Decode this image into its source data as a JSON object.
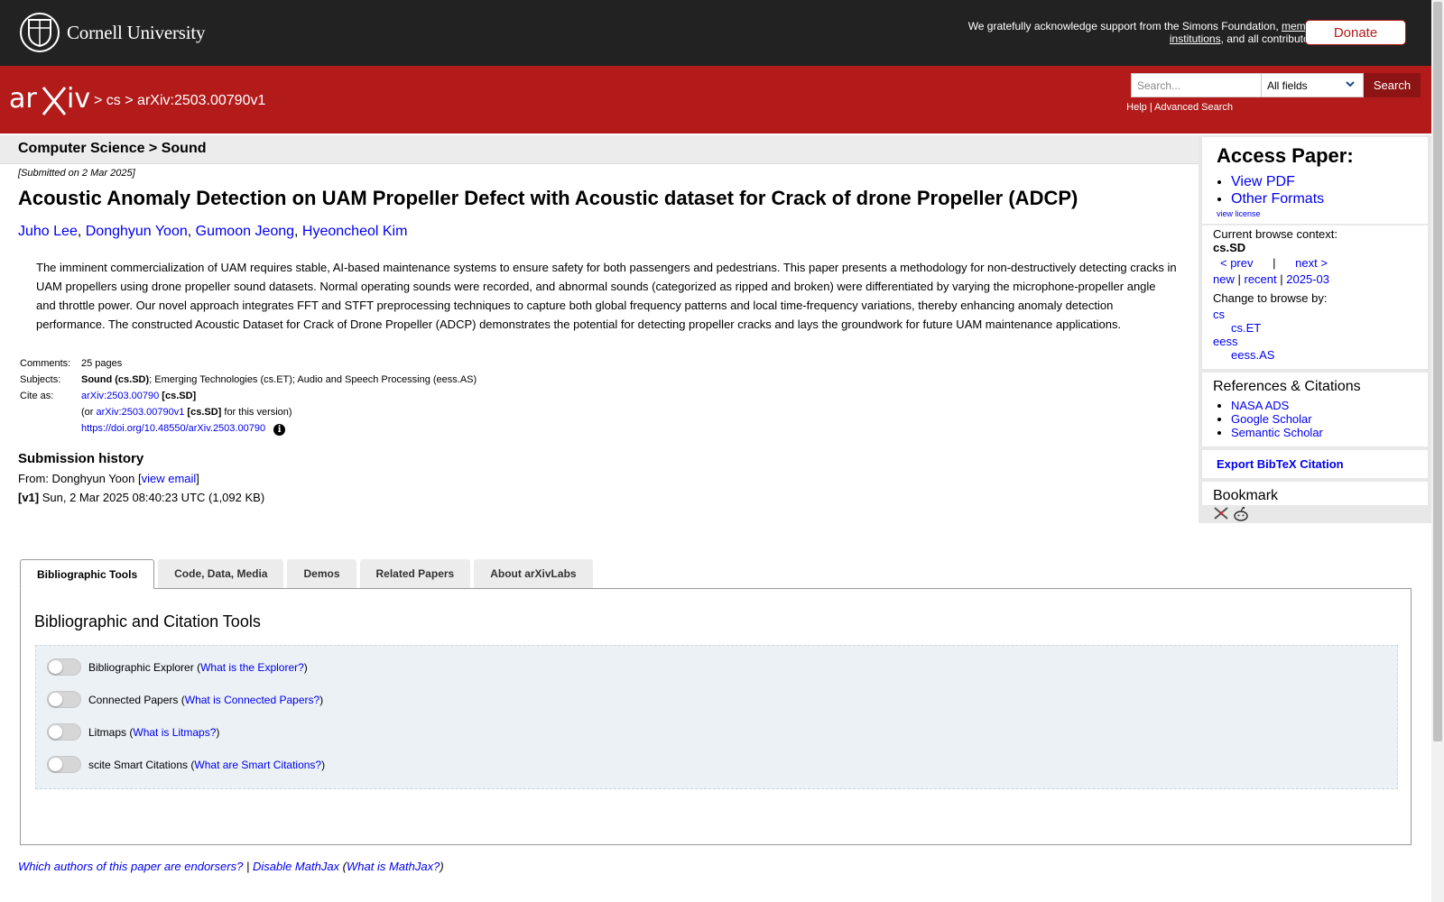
{
  "header": {
    "university": "Cornell University",
    "support_pre": "We gratefully acknowledge support from the Simons Foundation, ",
    "member_link": "member institutions",
    "support_post": ", and all contributors.",
    "donate": "Donate"
  },
  "nav": {
    "sep": ">",
    "crumb1": "cs",
    "crumb2": "arXiv:2503.00790v1",
    "search_placeholder": "Search...",
    "search_field": "All fields",
    "search_button": "Search",
    "help": "Help",
    "help_sep": "|",
    "advanced": "Advanced Search"
  },
  "subject_header": "Computer Science > Sound",
  "paper": {
    "submitted": "[Submitted on 2 Mar 2025]",
    "title": "Acoustic Anomaly Detection on UAM Propeller Defect with Acoustic dataset for Crack of drone Propeller (ADCP)",
    "authors": [
      "Juho Lee",
      "Donghyun Yoon",
      "Gumoon Jeong",
      "Hyeoncheol Kim"
    ],
    "abstract": "The imminent commercialization of UAM requires stable, AI-based maintenance systems to ensure safety for both passengers and pedestrians. This paper presents a methodology for non-destructively detecting cracks in UAM propellers using drone propeller sound datasets. Normal operating sounds were recorded, and abnormal sounds (categorized as ripped and broken) were differentiated by varying the microphone-propeller angle and throttle power. Our novel approach integrates FFT and STFT preprocessing techniques to capture both global frequency patterns and local time-frequency variations, thereby enhancing anomaly detection performance. The constructed Acoustic Dataset for Crack of Drone Propeller (ADCP) demonstrates the potential for detecting propeller cracks and lays the groundwork for future UAM maintenance applications.",
    "comments_label": "Comments:",
    "comments": "25 pages",
    "subjects_label": "Subjects:",
    "subjects_primary": "Sound (cs.SD)",
    "subjects_rest": "; Emerging Technologies (cs.ET); Audio and Speech Processing (eess.AS)",
    "cite_label": "Cite as:",
    "cite_id": "arXiv:2503.00790",
    "cite_cat": "[cs.SD]",
    "cite_or": "(or ",
    "cite_version": "arXiv:2503.00790v1",
    "cite_version_cat": "[cs.SD]",
    "cite_version_suffix": " for this version)",
    "doi": "https://doi.org/10.48550/arXiv.2503.00790"
  },
  "history": {
    "title": "Submission history",
    "from_label": "From: Donghyun Yoon [",
    "view_email": "view email",
    "from_close": "]",
    "v1_label": "[v1]",
    "v1_text": " Sun, 2 Mar 2025 08:40:23 UTC (1,092 KB)"
  },
  "sidebar": {
    "access_title": "Access Paper:",
    "view_pdf": "View PDF",
    "other_formats": "Other Formats",
    "view_license": "view license",
    "browse_context_label": "Current browse context:",
    "browse_context": "cs.SD",
    "prev": "< prev",
    "pipe": "|",
    "next": "next >",
    "new": "new",
    "recent": "recent",
    "month": "2025-03",
    "change_label": "Change to browse by:",
    "cats": [
      "cs",
      "cs.ET",
      "eess",
      "eess.AS"
    ],
    "refs_title": "References & Citations",
    "refs": [
      "NASA ADS",
      "Google Scholar",
      "Semantic Scholar"
    ],
    "export_bibtex": "Export BibTeX Citation",
    "bookmark_title": "Bookmark"
  },
  "tabs": [
    "Bibliographic Tools",
    "Code, Data, Media",
    "Demos",
    "Related Papers",
    "About arXivLabs"
  ],
  "panel": {
    "title": "Bibliographic and Citation Tools",
    "toggles": [
      {
        "label": "Bibliographic Explorer",
        "link": "What is the Explorer?"
      },
      {
        "label": "Connected Papers",
        "link": "What is Connected Papers?"
      },
      {
        "label": "Litmaps",
        "link": "What is Litmaps?"
      },
      {
        "label": "scite Smart Citations",
        "link": "What are Smart Citations?"
      }
    ]
  },
  "footer": {
    "endorsers": "Which authors of this paper are endorsers?",
    "sep": "|",
    "disable_mathjax": "Disable MathJax",
    "what_mathjax": "What is MathJax?"
  },
  "colors": {
    "brand_red": "#b31b1b",
    "topbar": "#222222",
    "link": "#0000ee"
  }
}
